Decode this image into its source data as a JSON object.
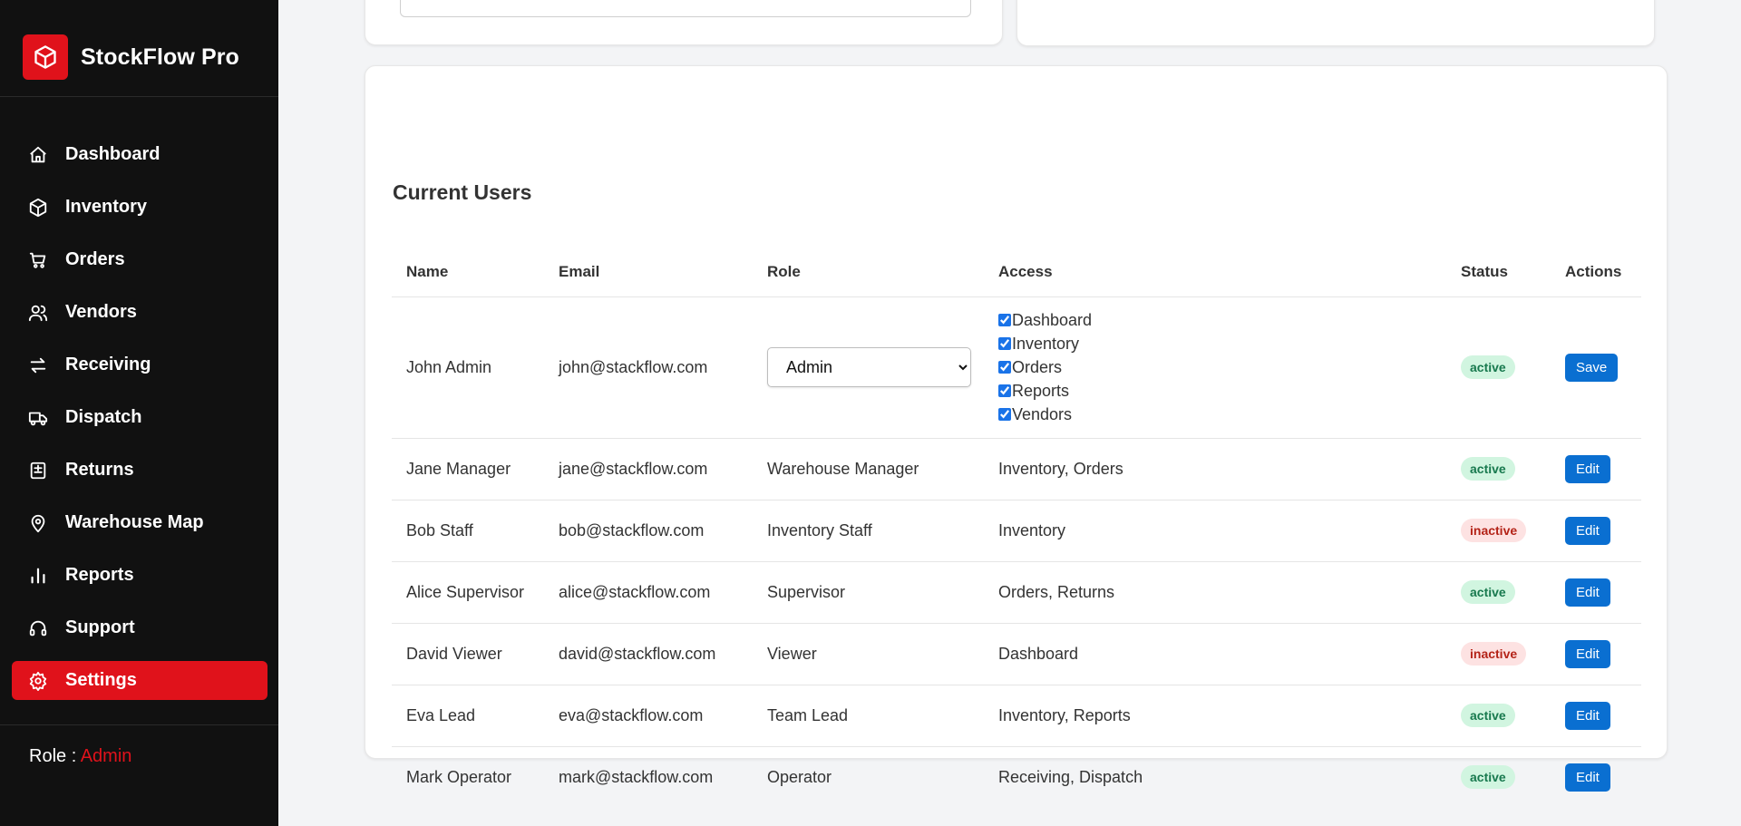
{
  "app": {
    "name": "StockFlow Pro",
    "logo_icon": "cube-icon",
    "accent": "#e0121b"
  },
  "sidebar": {
    "items": [
      {
        "label": "Dashboard",
        "icon": "home-icon"
      },
      {
        "label": "Inventory",
        "icon": "box-icon"
      },
      {
        "label": "Orders",
        "icon": "cart-icon"
      },
      {
        "label": "Vendors",
        "icon": "users-icon"
      },
      {
        "label": "Receiving",
        "icon": "arrows-icon"
      },
      {
        "label": "Dispatch",
        "icon": "truck-icon"
      },
      {
        "label": "Returns",
        "icon": "receipt-icon"
      },
      {
        "label": "Warehouse Map",
        "icon": "map-pin-icon"
      },
      {
        "label": "Reports",
        "icon": "bar-chart-icon"
      },
      {
        "label": "Support",
        "icon": "headset-icon"
      },
      {
        "label": "Settings",
        "icon": "gear-icon",
        "active": true
      }
    ],
    "role_label": "Role :",
    "role_value": "Admin"
  },
  "users": {
    "title": "Current Users",
    "columns": [
      "Name",
      "Email",
      "Role",
      "Access",
      "Status",
      "Actions"
    ],
    "editing": {
      "name": "John Admin",
      "email": "john@stackflow.com",
      "role_selected": "Admin",
      "permissions": [
        "Dashboard",
        "Inventory",
        "Orders",
        "Reports",
        "Vendors"
      ],
      "status": "active",
      "action": "Save"
    },
    "rows": [
      {
        "name": "Jane Manager",
        "email": "jane@stackflow.com",
        "role": "Warehouse Manager",
        "access": "Inventory, Orders",
        "status": "active",
        "action": "Edit"
      },
      {
        "name": "Bob Staff",
        "email": "bob@stackflow.com",
        "role": "Inventory Staff",
        "access": "Inventory",
        "status": "inactive",
        "action": "Edit"
      },
      {
        "name": "Alice Supervisor",
        "email": "alice@stackflow.com",
        "role": "Supervisor",
        "access": "Orders, Returns",
        "status": "active",
        "action": "Edit"
      },
      {
        "name": "David Viewer",
        "email": "david@stackflow.com",
        "role": "Viewer",
        "access": "Dashboard",
        "status": "inactive",
        "action": "Edit"
      },
      {
        "name": "Eva Lead",
        "email": "eva@stackflow.com",
        "role": "Team Lead",
        "access": "Inventory, Reports",
        "status": "active",
        "action": "Edit"
      },
      {
        "name": "Mark Operator",
        "email": "mark@stackflow.com",
        "role": "Operator",
        "access": "Receiving, Dispatch",
        "status": "active",
        "action": "Edit"
      }
    ]
  }
}
